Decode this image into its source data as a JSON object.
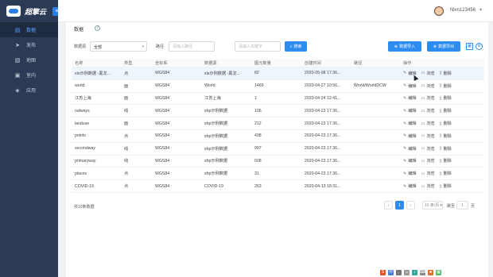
{
  "app": {
    "brand": "超擎云"
  },
  "sidebar": {
    "items": [
      {
        "icon": "database-icon",
        "label": "数据",
        "active": true
      },
      {
        "icon": "send-icon",
        "label": "发布",
        "active": false
      },
      {
        "icon": "map-icon",
        "label": "地图",
        "active": false
      },
      {
        "icon": "inbox-icon",
        "label": "室内",
        "active": false
      },
      {
        "icon": "app-icon",
        "label": "应用",
        "active": false
      }
    ]
  },
  "header": {
    "username": "Nlvn123456",
    "caret": "▾"
  },
  "panel": {
    "title": "数据"
  },
  "filters": {
    "source_label": "数据源",
    "source_value": "全部",
    "path_label": "路径",
    "path_placeholder": "请输入路径",
    "name_placeholder": "请输入关键字",
    "search_label": "搜索",
    "import_label": "数据导入",
    "export_label": "数据导出"
  },
  "table": {
    "columns": [
      "名称",
      "类型",
      "坐标系",
      "数据源",
      "图元数量",
      "创建时间",
      "路径",
      "操作"
    ],
    "ops": {
      "edit": "编辑",
      "browse": "浏览",
      "delete": "删除"
    },
    "rows": [
      {
        "name": "xls示例数据 -黑龙...",
        "type": "点",
        "crs": "WGS84",
        "src": "xls示例数据 -黑龙...",
        "count": "82",
        "time": "2020-05-08 17:36...",
        "path": ""
      },
      {
        "name": "world",
        "type": "面",
        "crs": "WGS84",
        "src": "World",
        "count": "1469",
        "time": "2020-04-27 10:56...",
        "path": "World/WorldDCW"
      },
      {
        "name": "江苏上海",
        "type": "面",
        "crs": "WGS84",
        "src": "江苏上海",
        "count": "1",
        "time": "2020-04-24 12:41...",
        "path": ""
      },
      {
        "name": "railways",
        "type": "线",
        "crs": "WGS84",
        "src": "shp示例数据",
        "count": "106",
        "time": "2020-04-23 17:36...",
        "path": ""
      },
      {
        "name": "landuse",
        "type": "面",
        "crs": "WGS84",
        "src": "shp示例数据",
        "count": "212",
        "time": "2020-04-23 17:36...",
        "path": ""
      },
      {
        "name": "points",
        "type": "点",
        "crs": "WGS84",
        "src": "shp示例数据",
        "count": "438",
        "time": "2020-04-23 17:36...",
        "path": ""
      },
      {
        "name": "secondway",
        "type": "线",
        "crs": "WGS84",
        "src": "shp示例数据",
        "count": "997",
        "time": "2020-04-23 17:36...",
        "path": ""
      },
      {
        "name": "primaryway",
        "type": "线",
        "crs": "WGS84",
        "src": "shp示例数据",
        "count": "608",
        "time": "2020-04-23 17:36...",
        "path": ""
      },
      {
        "name": "places",
        "type": "点",
        "crs": "WGS84",
        "src": "shp示例数据",
        "count": "31",
        "time": "2020-04-23 17:36...",
        "path": ""
      },
      {
        "name": "COVID-19",
        "type": "点",
        "crs": "WGS84",
        "src": "COVID-19",
        "count": "263",
        "time": "2020-04-13 18:31...",
        "path": ""
      }
    ]
  },
  "pagination": {
    "total": "共10条数据",
    "prev": "‹",
    "current": "1",
    "next": "›",
    "page_size": "10 条/页",
    "jump_label": "跳至",
    "jump_value": "1",
    "page_unit": "页"
  },
  "colors": {
    "sidebar": "#2b3a55",
    "accent": "#2d8cf0",
    "highlight_row": "#eef5fd"
  }
}
